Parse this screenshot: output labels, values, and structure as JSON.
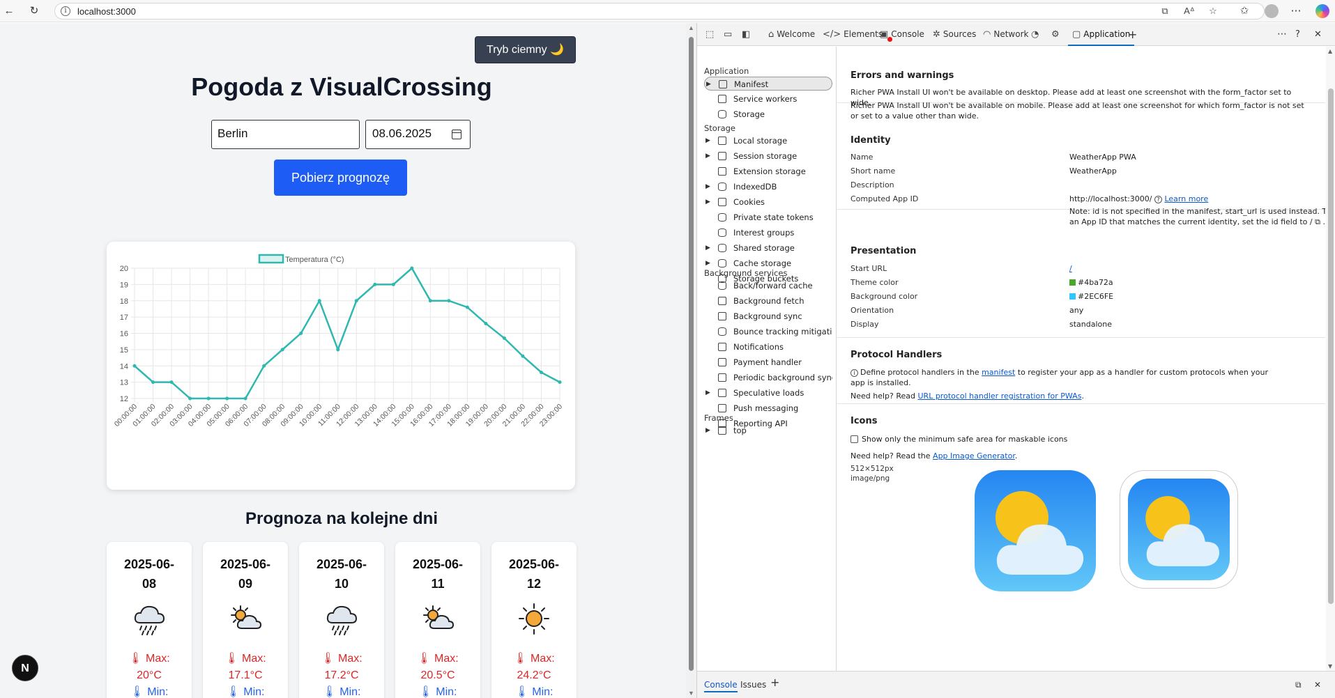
{
  "browser": {
    "url": "localhost:3000",
    "icons": [
      "back-arrow-icon",
      "refresh-icon",
      "info-icon",
      "open-in-app-icon",
      "read-aloud-icon",
      "favorite-star-icon",
      "favorites-icon",
      "profile-icon",
      "more-icon",
      "copilot-icon"
    ]
  },
  "page": {
    "theme_button": "Tryb ciemny 🌙",
    "title": "Pogoda z VisualCrossing",
    "city_value": "Berlin",
    "date_value": "08.06.2025",
    "fetch_button": "Pobierz prognozę",
    "forecast_title": "Prognoza na kolejne dni",
    "next_badge": "N",
    "days": [
      {
        "date_line1": "2025-06-",
        "date_line2": "08",
        "icon": "rain-cloud-icon",
        "max_label": "🌡 Max:",
        "max_value": "20°C",
        "min_label": "🌡 Min:"
      },
      {
        "date_line1": "2025-06-",
        "date_line2": "09",
        "icon": "partly-cloudy-icon",
        "max_label": "🌡 Max:",
        "max_value": "17.1°C",
        "min_label": "🌡 Min:"
      },
      {
        "date_line1": "2025-06-",
        "date_line2": "10",
        "icon": "rain-cloud-icon",
        "max_label": "🌡 Max:",
        "max_value": "17.2°C",
        "min_label": "🌡 Min:"
      },
      {
        "date_line1": "2025-06-",
        "date_line2": "11",
        "icon": "partly-cloudy-icon",
        "max_label": "🌡 Max:",
        "max_value": "20.5°C",
        "min_label": "🌡 Min:"
      },
      {
        "date_line1": "2025-06-",
        "date_line2": "12",
        "icon": "sun-icon",
        "max_label": "🌡 Max:",
        "max_value": "24.2°C",
        "min_label": "🌡 Min:"
      }
    ]
  },
  "chart_data": {
    "type": "line",
    "title": "",
    "legend": "Temperatura (°C)",
    "legend_placement": "top-center",
    "series": [
      {
        "name": "Temperatura (°C)",
        "color": "#2eb8b0",
        "values": [
          14,
          13,
          13,
          12,
          12,
          12,
          12,
          14,
          15,
          16,
          18,
          15,
          18,
          19,
          19,
          20,
          18,
          18,
          17.6,
          16.6,
          15.7,
          14.6,
          13.6,
          13
        ]
      }
    ],
    "categories": [
      "00:00:00",
      "01:00:00",
      "02:00:00",
      "03:00:00",
      "04:00:00",
      "05:00:00",
      "06:00:00",
      "07:00:00",
      "08:00:00",
      "09:00:00",
      "10:00:00",
      "11:00:00",
      "12:00:00",
      "13:00:00",
      "14:00:00",
      "15:00:00",
      "16:00:00",
      "17:00:00",
      "18:00:00",
      "19:00:00",
      "20:00:00",
      "21:00:00",
      "22:00:00",
      "23:00:00"
    ],
    "yticks": [
      "12",
      "13",
      "14",
      "15",
      "16",
      "17",
      "18",
      "19",
      "20"
    ],
    "ylim": [
      12,
      20
    ],
    "grid": true
  },
  "devtools": {
    "tabs": [
      {
        "label": "",
        "icon": "device-inspect-icon"
      },
      {
        "label": "",
        "icon": "device-emulation-icon"
      },
      {
        "label": "",
        "icon": "dock-side-icon"
      },
      {
        "label": "Welcome",
        "icon": "home-icon"
      },
      {
        "label": "Elements",
        "icon": "code-icon"
      },
      {
        "label": "Console",
        "icon": "console-icon"
      },
      {
        "label": "Sources",
        "icon": "sources-icon"
      },
      {
        "label": "Network",
        "icon": "wifi-icon"
      },
      {
        "label": "",
        "icon": "performance-icon"
      },
      {
        "label": "",
        "icon": "settings-gear-icon"
      },
      {
        "label": "Application",
        "icon": "application-icon"
      }
    ],
    "sidebar": {
      "app_header": "Application",
      "app_items": [
        "Manifest",
        "Service workers",
        "Storage"
      ],
      "storage_header": "Storage",
      "storage_items": [
        "Local storage",
        "Session storage",
        "Extension storage",
        "IndexedDB",
        "Cookies",
        "Private state tokens",
        "Interest groups",
        "Shared storage",
        "Cache storage",
        "Storage buckets"
      ],
      "bg_header": "Background services",
      "bg_items": [
        "Back/forward cache",
        "Background fetch",
        "Background sync",
        "Bounce tracking mitigati...",
        "Notifications",
        "Payment handler",
        "Periodic background sync",
        "Speculative loads",
        "Push messaging",
        "Reporting API"
      ],
      "frames_header": "Frames",
      "frames_items": [
        "top"
      ]
    },
    "errors": {
      "title": "Errors and warnings",
      "w1": "Richer PWA Install UI won't be available on desktop. Please add at least one screenshot with the form_factor set to wide.",
      "w2": "Richer PWA Install UI won't be available on mobile. Please add at least one screenshot for which form_factor is not set or set to a value other than wide."
    },
    "identity": {
      "title": "Identity",
      "name_label": "Name",
      "name": "WeatherApp PWA",
      "short_label": "Short name",
      "short_name": "WeatherApp",
      "desc_label": "Description",
      "appid_label": "Computed App ID",
      "appid": "http://localhost:3000/",
      "learn_more": "Learn more",
      "note": "Note: id is not specified in the manifest, start_url is used instead. To specify an App ID that matches the current identity, set the id field to /"
    },
    "presentation": {
      "title": "Presentation",
      "start_label": "Start URL",
      "start_url": "/",
      "theme_label": "Theme color",
      "theme_color": "#4ba72a",
      "bg_label": "Background color",
      "bg_color": "#2EC6FE",
      "orient_label": "Orientation",
      "orientation": "any",
      "display_label": "Display",
      "display": "standalone"
    },
    "protocol": {
      "title": "Protocol Handlers",
      "line1_a": "Define protocol handlers in the",
      "line1_link": "manifest",
      "line1_b": "to register your app as a handler for custom protocols when your app is installed.",
      "help_a": "Need help? Read",
      "help_link": "URL protocol handler registration for PWAs",
      "help_b": "."
    },
    "icons": {
      "title": "Icons",
      "checkbox_label": "Show only the minimum safe area for maskable icons",
      "help_a": "Need help? Read the",
      "help_link": "App Image Generator",
      "help_b": ".",
      "size": "512×512px",
      "type": "image/png"
    },
    "bottom_tabs": [
      "Console",
      "Issues"
    ]
  }
}
